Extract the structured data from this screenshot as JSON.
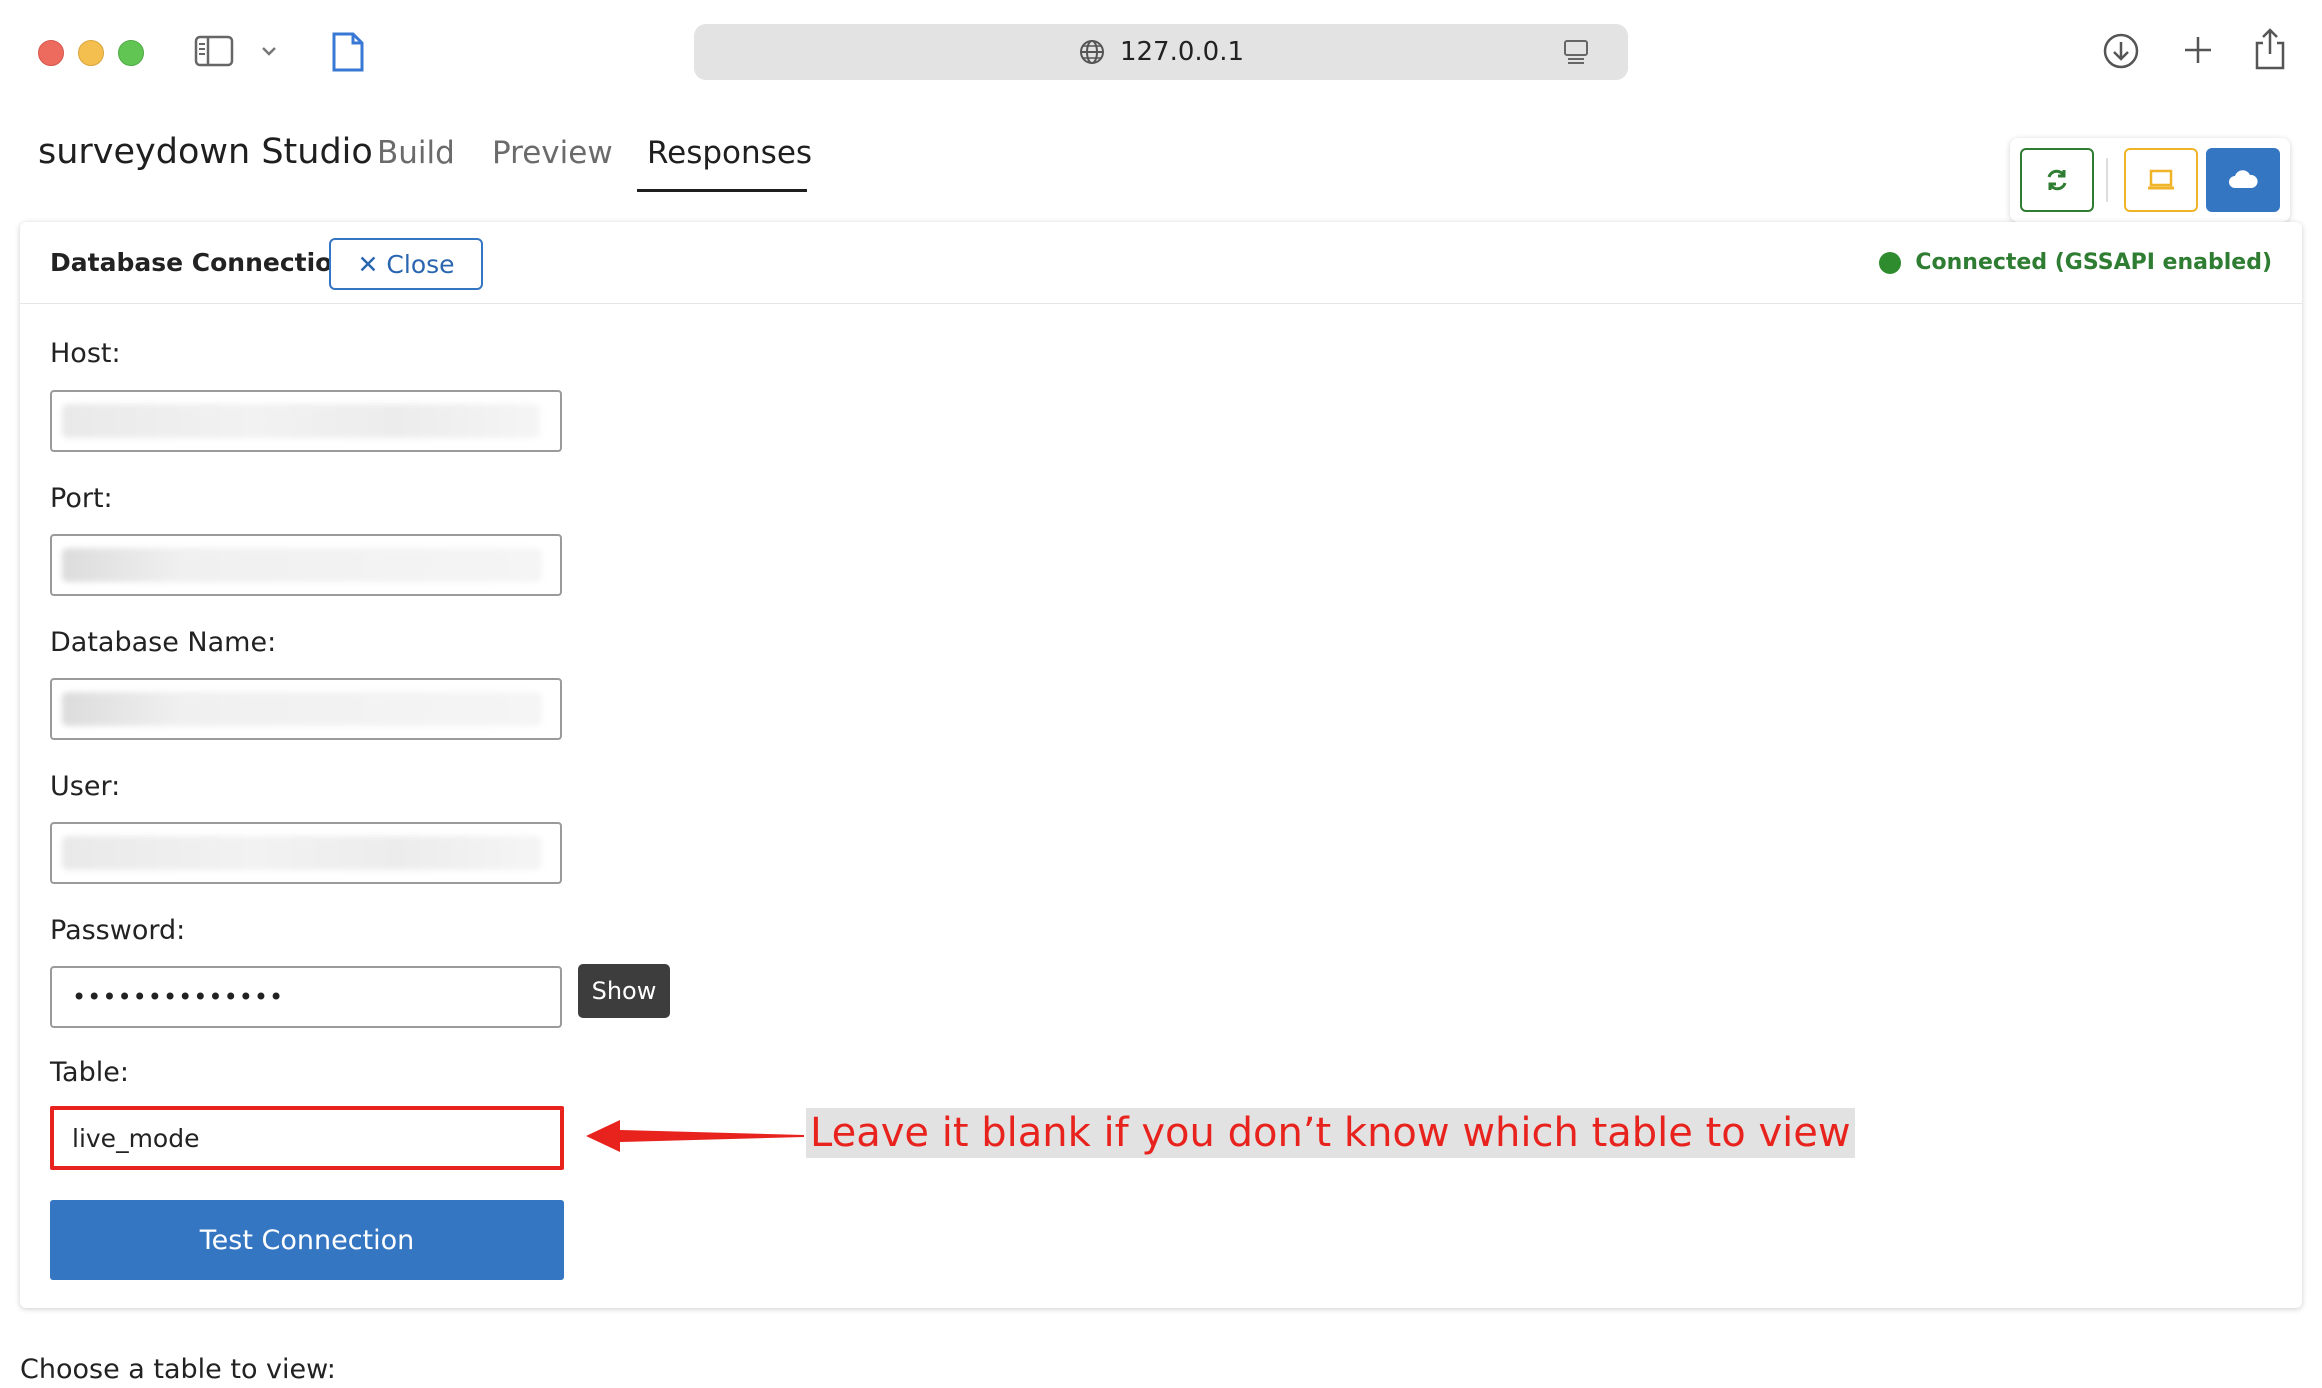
{
  "browser": {
    "url": "127.0.0.1"
  },
  "app": {
    "brand": "surveydown Studio",
    "tabs": [
      {
        "label": "Build",
        "active": false
      },
      {
        "label": "Preview",
        "active": false
      },
      {
        "label": "Responses",
        "active": true
      }
    ],
    "toolbar": {
      "refresh_icon": "refresh-icon",
      "local_icon": "laptop-icon",
      "cloud_icon": "cloud-icon",
      "colors": {
        "refresh": "#2e7d32",
        "local": "#f0b429",
        "cloud": "#3476c2"
      }
    }
  },
  "connection_panel": {
    "title": "Database Connection",
    "close_label": "Close",
    "status_text": "Connected (GSSAPI enabled)",
    "status_color": "#2e8b2e",
    "fields": {
      "host": {
        "label": "Host:"
      },
      "port": {
        "label": "Port:"
      },
      "db_name": {
        "label": "Database Name:"
      },
      "user": {
        "label": "User:"
      },
      "password": {
        "label": "Password:",
        "value": "••••••••••••••"
      },
      "table": {
        "label": "Table:",
        "value": "live_mode"
      }
    },
    "show_label": "Show",
    "test_label": "Test Connection"
  },
  "annotation": {
    "text": "Leave it blank if you don’t know which table to view",
    "color": "#e8231e"
  },
  "below_panel": {
    "choose_label": "Choose a table to view:"
  }
}
